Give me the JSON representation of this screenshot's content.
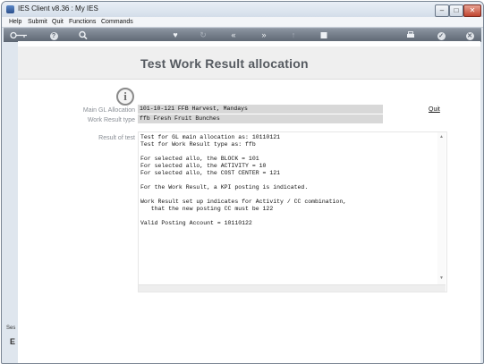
{
  "window": {
    "title": "IES Client v8.36 : My IES",
    "min": "–",
    "max": "□",
    "close": "✕"
  },
  "menu": [
    "Help",
    "Submit",
    "Quit",
    "Functions",
    "Commands"
  ],
  "toolbar": {
    "icons": [
      "key-icon",
      "help-icon",
      "search-icon",
      "heart-icon",
      "refresh-icon",
      "rewind-icon",
      "forward-icon",
      "upload-icon",
      "stop-icon",
      "print-icon",
      "check-icon",
      "close-icon"
    ]
  },
  "page": {
    "title": "Test Work Result allocation"
  },
  "fields": {
    "main_gl_label": "Main GL Allocation",
    "main_gl_value": "101-10-121 FFB Harvest, Mandays",
    "work_result_label": "Work Result type",
    "work_result_value": "ffb Fresh Fruit Bunches",
    "result_label": "Result of test"
  },
  "quit_link": "Quit",
  "result_lines": [
    "Test for GL main allocation as: 10110121",
    "Test for Work Result type as: ffb",
    "",
    "For selected allo, the BLOCK = 101",
    "For selected allo, the ACTIVITY = 10",
    "For selected allo, the COST CENTER = 121",
    "",
    "For the Work Result, a KPI posting is indicated.",
    "",
    "Work Result set up indicates for Activity / CC combination,",
    "   that the new posting CC must be 122",
    "",
    "Valid Posting Account = 10110122"
  ],
  "side_fragments": {
    "top": "Ses",
    "bottom": "E"
  }
}
